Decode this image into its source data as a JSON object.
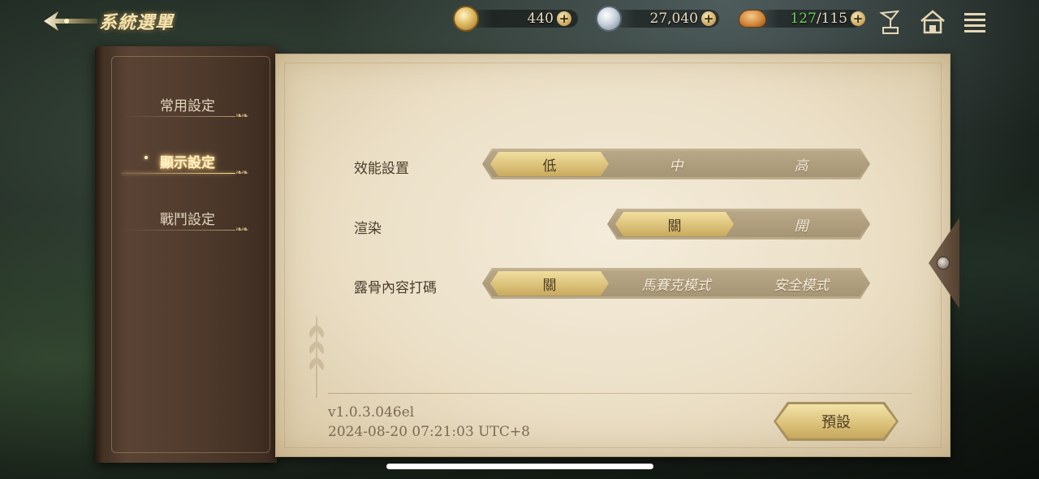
{
  "header": {
    "title": "系統選單",
    "back_icon": "back-arrow-icon"
  },
  "resources": [
    {
      "icon": "gold-coin-icon",
      "value": "440"
    },
    {
      "icon": "silver-coin-icon",
      "value": "27,040"
    },
    {
      "icon": "bread-icon",
      "current": "127",
      "max": "/115"
    }
  ],
  "top_icons": [
    "gramophone-icon",
    "home-icon",
    "menu-icon"
  ],
  "sidebar": {
    "items": [
      {
        "label": "常用設定",
        "active": false
      },
      {
        "label": "顯示設定",
        "active": true
      },
      {
        "label": "戰鬥設定",
        "active": false
      }
    ]
  },
  "settings": [
    {
      "label": "效能設置",
      "options": [
        "低",
        "中",
        "高"
      ],
      "selected": "低"
    },
    {
      "label": "渲染",
      "options": [
        "關",
        "開"
      ],
      "selected": "關"
    },
    {
      "label": "露骨內容打碼",
      "options": [
        "關",
        "馬賽克模式",
        "安全模式"
      ],
      "selected": "關"
    }
  ],
  "footer": {
    "version": "v1.0.3.046el",
    "timestamp": "2024-08-20 07:21:03 UTC+8",
    "reset_label": "預設"
  },
  "colors": {
    "accent_gold": "#dcc27a",
    "parchment": "#ebdfc6",
    "book_leather": "#4e3a2c",
    "stamina_current": "#6fd05a"
  }
}
